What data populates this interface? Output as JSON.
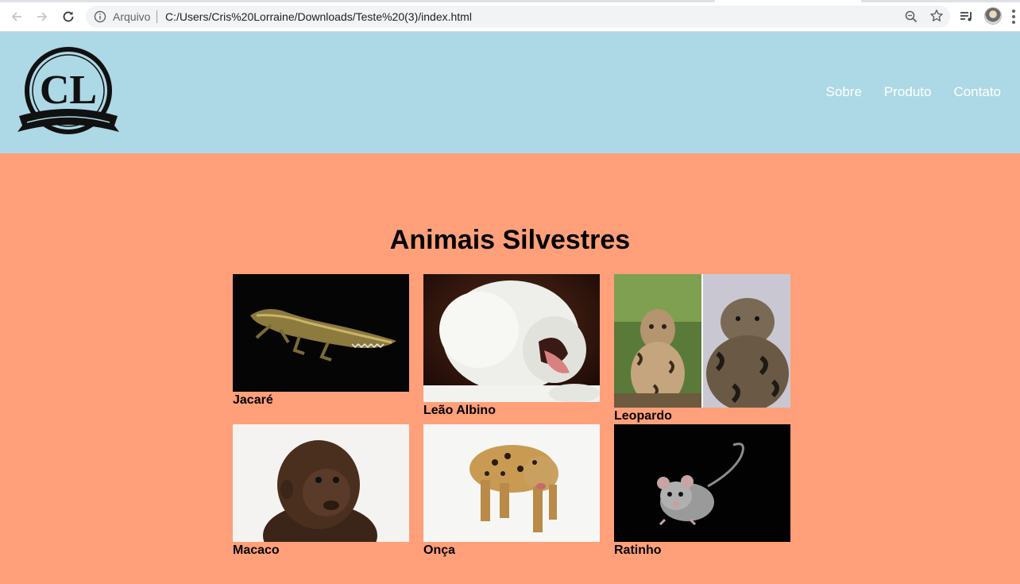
{
  "browser": {
    "scheme_label": "Arquivo",
    "url": "C:/Users/Cris%20Lorraine/Downloads/Teste%20(3)/index.html"
  },
  "site": {
    "logo_text": "CL",
    "nav": [
      {
        "label": "Sobre"
      },
      {
        "label": "Produto"
      },
      {
        "label": "Contato"
      }
    ]
  },
  "main": {
    "title": "Animais Silvestres",
    "animals": [
      {
        "label": "Jacaré",
        "image": "crocodile-photo"
      },
      {
        "label": "Leão Albino",
        "image": "white-lion-photo"
      },
      {
        "label": "Leopardo",
        "image": "clouded-leopard-photo"
      },
      {
        "label": "Macaco",
        "image": "baby-gorilla-photo"
      },
      {
        "label": "Onça",
        "image": "jaguar-photo"
      },
      {
        "label": "Ratinho",
        "image": "possum-photo"
      }
    ]
  },
  "colors": {
    "header_bg": "#add8e6",
    "page_bg": "#ffa07a",
    "nav_text": "#ffffff"
  }
}
